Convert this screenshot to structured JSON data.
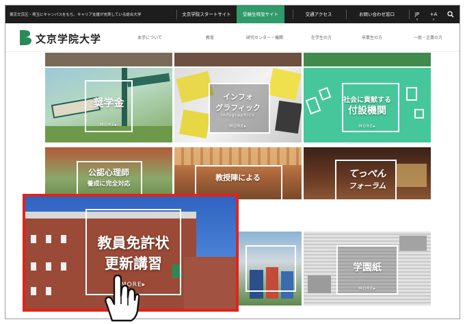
{
  "topbar": {
    "tagline": "東京文京区・埼玉にキャンパスをもち、キャリア支援が充実している総合大学",
    "links": [
      "文京学院スタートサイト",
      "受験生特設サイト",
      "交通アクセス",
      "お問い合わせ窓口"
    ],
    "lang": "JP",
    "font_size": "+A",
    "search_icon": "search-icon",
    "active_color": "#2f9a6a"
  },
  "header": {
    "logo_text": "文京学院大学",
    "nav": [
      "本学について",
      "教育",
      "研究センター・機関",
      "在学生の方",
      "卒業生の方",
      "一般・企業の方"
    ]
  },
  "tiles": [
    {
      "title": "奨学金",
      "more": "MORE▸"
    },
    {
      "title_line1": "インフォ",
      "title_line2": "グラフィック",
      "subtitle": "Infographics",
      "more": "MORE▸"
    },
    {
      "title_line1": "社会に貢献する",
      "title_line2": "付設機関",
      "more": "MORE▸"
    },
    {
      "title_line1": "公認心理師",
      "title_line2": "養成に完全対応"
    },
    {
      "title_line1": "教授陣による"
    },
    {
      "title_line1": "てっぺん",
      "title_line2": "フォーラム"
    },
    {
      "title_line1": "学園紙",
      "more": "MORE▸"
    }
  ],
  "featured": {
    "title_line1": "教員免許状",
    "title_line2": "更新講習",
    "more": "MORE▸",
    "border_color": "#e2231a"
  }
}
